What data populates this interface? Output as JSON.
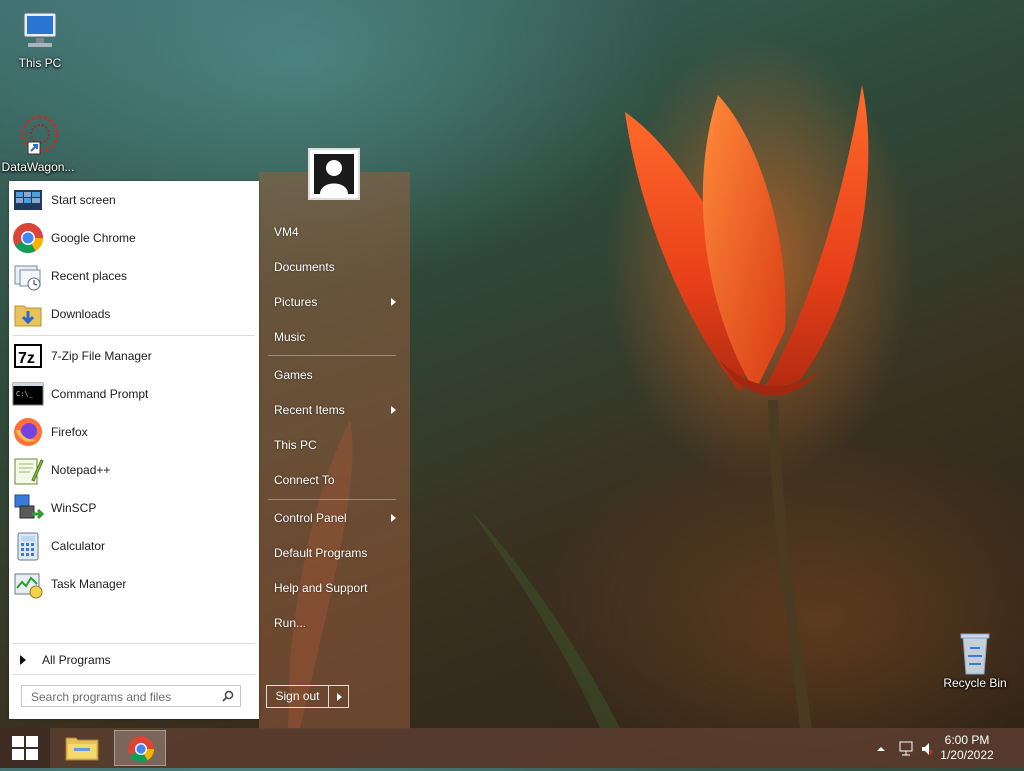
{
  "desktop": {
    "icons": [
      {
        "label": "This PC"
      },
      {
        "label": "DataWagon..."
      },
      {
        "label": "Recycle Bin"
      }
    ]
  },
  "start_menu": {
    "pinned": [
      {
        "label": "Start screen",
        "icon": "start-screen-icon"
      },
      {
        "label": "Google Chrome",
        "icon": "chrome-icon"
      },
      {
        "label": "Recent places",
        "icon": "recent-places-icon"
      },
      {
        "label": "Downloads",
        "icon": "downloads-folder-icon"
      }
    ],
    "recent": [
      {
        "label": "7-Zip File Manager",
        "icon": "7zip-icon"
      },
      {
        "label": "Command Prompt",
        "icon": "command-prompt-icon"
      },
      {
        "label": "Firefox",
        "icon": "firefox-icon"
      },
      {
        "label": "Notepad++",
        "icon": "notepadpp-icon"
      },
      {
        "label": "WinSCP",
        "icon": "winscp-icon"
      },
      {
        "label": "Calculator",
        "icon": "calculator-icon"
      },
      {
        "label": "Task Manager",
        "icon": "task-manager-icon"
      }
    ],
    "all_programs": "All Programs",
    "search_placeholder": "Search programs and files",
    "right": {
      "user": "VM4",
      "documents": "Documents",
      "pictures": "Pictures",
      "music": "Music",
      "games": "Games",
      "recent_items": "Recent Items",
      "this_pc": "This PC",
      "connect_to": "Connect To",
      "control_panel": "Control Panel",
      "default_programs": "Default Programs",
      "help_support": "Help and Support",
      "run": "Run..."
    },
    "sign_out": "Sign out"
  },
  "taskbar": {
    "time": "6:00 PM",
    "date": "1/20/2022"
  },
  "colors": {
    "start_left_bg": "#ffffff",
    "start_right_bg": "#965c3c",
    "taskbar_bg": "#5c3e30"
  }
}
